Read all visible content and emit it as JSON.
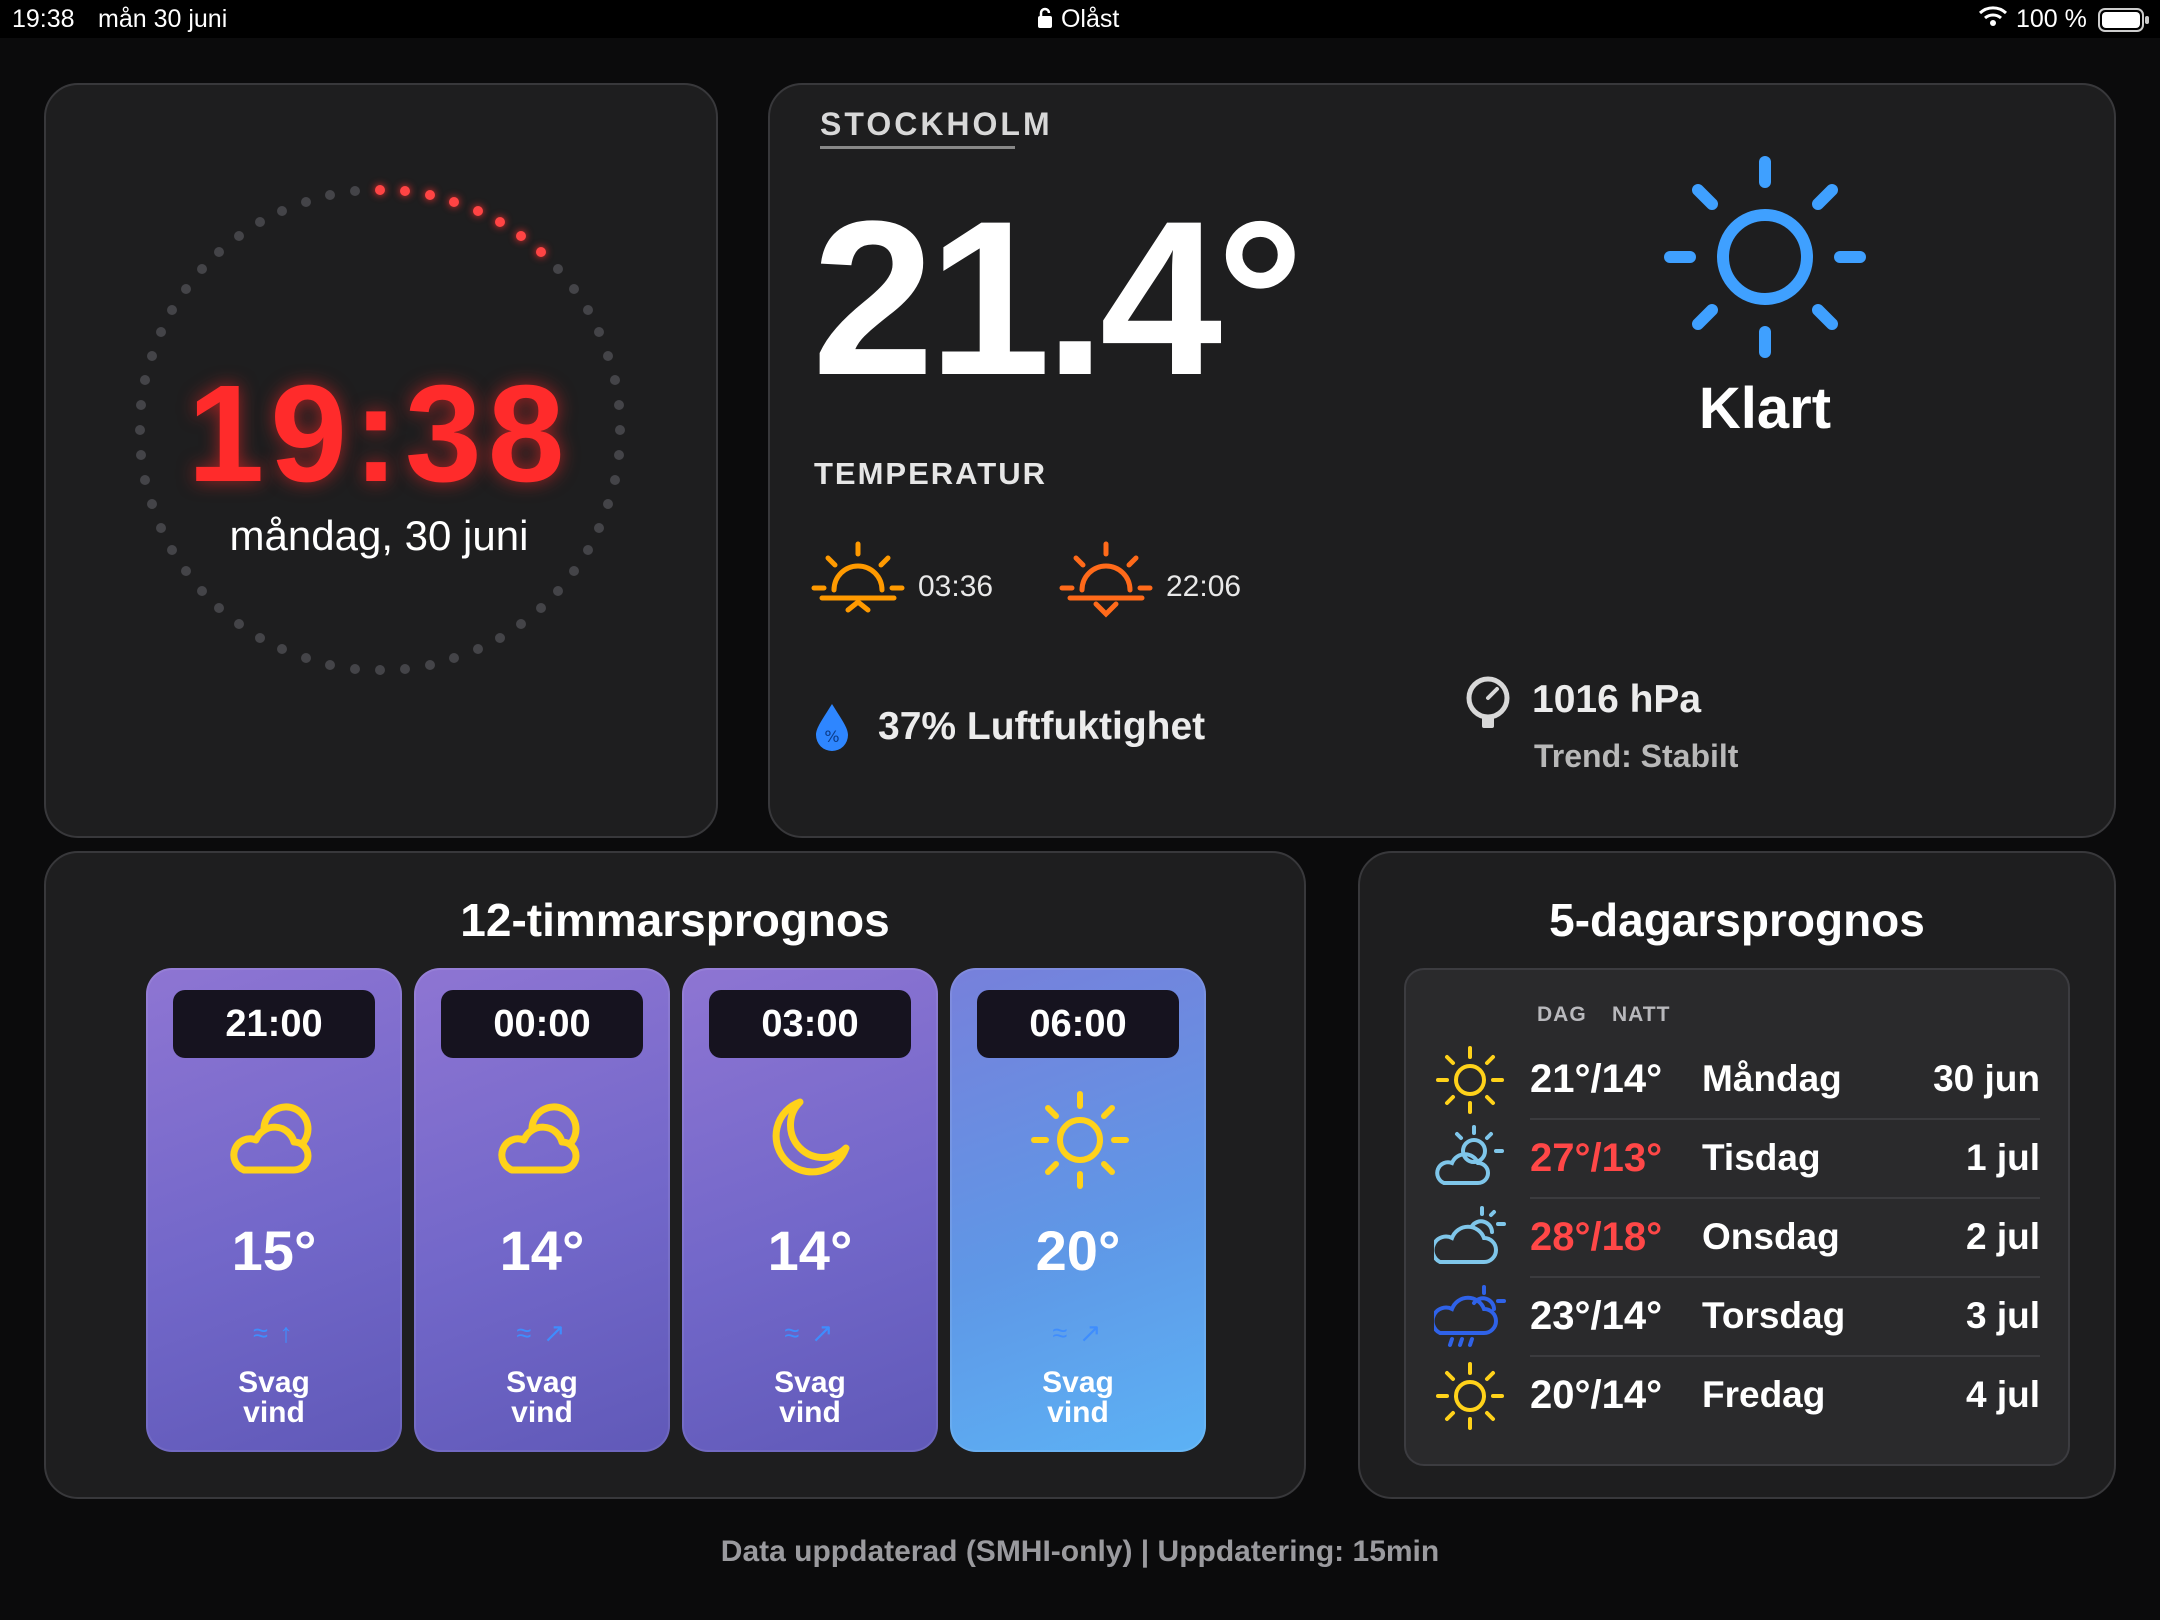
{
  "status_bar": {
    "time": "19:38",
    "date": "mån 30 juni",
    "lock": "Olåst",
    "battery": "100 %"
  },
  "clock": {
    "time": "19:38",
    "date": "måndag, 30 juni",
    "seconds_progress": 0.13,
    "accent": "#ff2b2b"
  },
  "current": {
    "city": "STOCKHOLM",
    "temperature": "21.4°",
    "temperature_label": "TEMPERATUR",
    "sunrise": "03:36",
    "sunset": "22:06",
    "condition": "Klart",
    "condition_icon": "sun-icon",
    "humidity": "37% Luftfuktighet",
    "pressure": "1016 hPa",
    "pressure_trend": "Trend: Stabilt"
  },
  "hourly": {
    "title": "12-timmarsprognos",
    "items": [
      {
        "time": "21:00",
        "icon": "partly-cloudy-night-icon",
        "temp": "15°",
        "wind_line1": "Svag",
        "wind_line2": "vind"
      },
      {
        "time": "00:00",
        "icon": "partly-cloudy-night-icon",
        "temp": "14°",
        "wind_line1": "Svag",
        "wind_line2": "vind"
      },
      {
        "time": "03:00",
        "icon": "moon-icon",
        "temp": "14°",
        "wind_line1": "Svag",
        "wind_line2": "vind"
      },
      {
        "time": "06:00",
        "icon": "sun-icon",
        "temp": "20°",
        "wind_line1": "Svag",
        "wind_line2": "vind"
      }
    ]
  },
  "daily": {
    "title": "5-dagarsprognos",
    "col_day": "DAG",
    "col_night": "NATT",
    "rows": [
      {
        "icon": "sun-icon",
        "temps": "21°/14°",
        "day": "Måndag",
        "date": "30 jun",
        "hot": false
      },
      {
        "icon": "partly-cloudy-icon",
        "temps": "27°/13°",
        "day": "Tisdag",
        "date": "1 jul",
        "hot": true
      },
      {
        "icon": "cloud-sun-icon",
        "temps": "28°/18°",
        "day": "Onsdag",
        "date": "2 jul",
        "hot": true
      },
      {
        "icon": "rain-cloud-icon",
        "temps": "23°/14°",
        "day": "Torsdag",
        "date": "3 jul",
        "hot": false
      },
      {
        "icon": "sun-icon",
        "temps": "20°/14°",
        "day": "Fredag",
        "date": "4 jul",
        "hot": false
      }
    ]
  },
  "footer": "Data uppdaterad (SMHI-only) | Uppdatering: 15min",
  "colors": {
    "hot": "#ff4747",
    "sun_yellow": "#ffd21a",
    "sun_blue": "#3fa0ff",
    "sunrise_orange": "#ff9a00",
    "sunset_orange": "#ff6a1a"
  }
}
